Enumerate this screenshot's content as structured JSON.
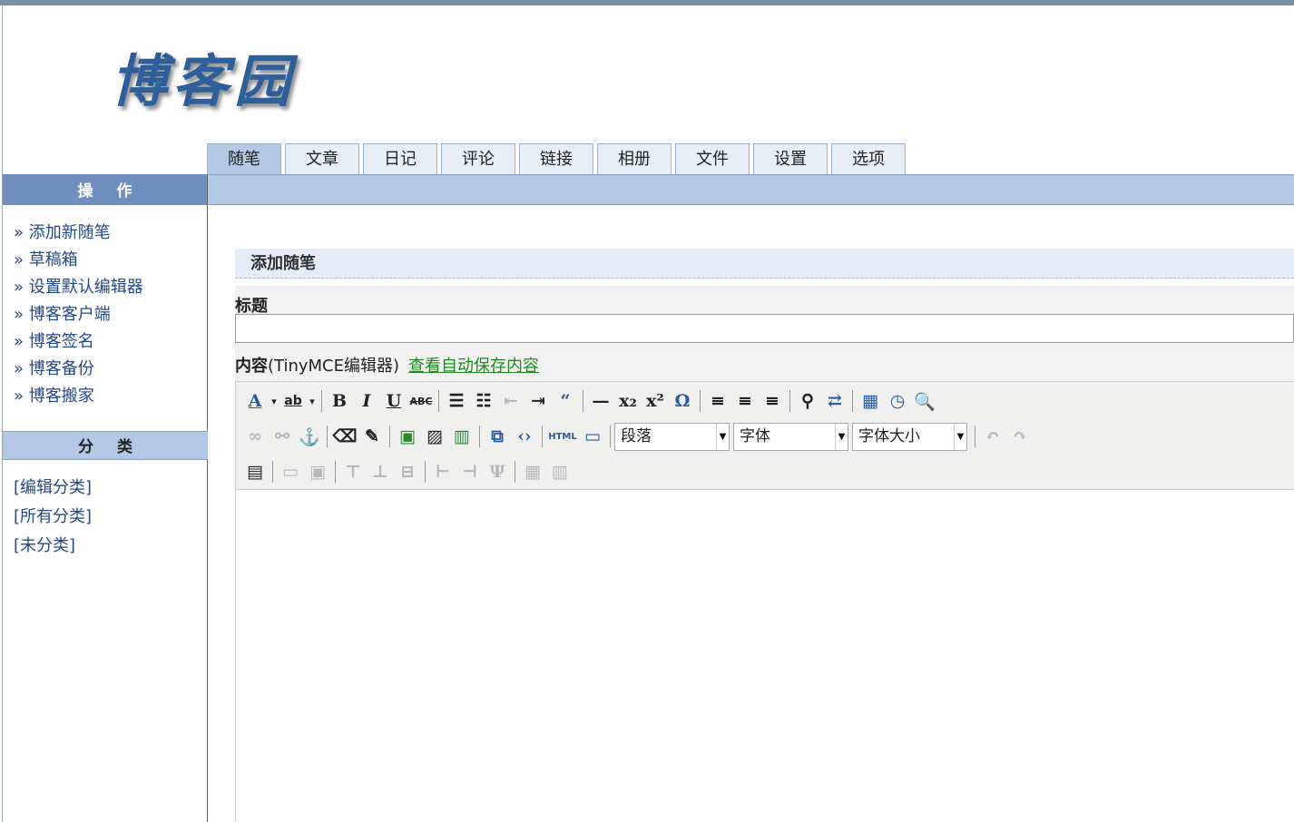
{
  "logo": {
    "text": "博客园"
  },
  "tabs": [
    {
      "label": "随笔",
      "active": true
    },
    {
      "label": "文章"
    },
    {
      "label": "日记"
    },
    {
      "label": "评论"
    },
    {
      "label": "链接"
    },
    {
      "label": "相册"
    },
    {
      "label": "文件"
    },
    {
      "label": "设置"
    },
    {
      "label": "选项"
    }
  ],
  "sidebar": {
    "ops_header": "操作",
    "ops": [
      "» 添加新随笔",
      "» 草稿箱",
      "» 设置默认编辑器",
      "» 博客客户端",
      "» 博客签名",
      "» 博客备份",
      "» 博客搬家"
    ],
    "cat_header": "分类",
    "cats": [
      "[编辑分类]",
      "[所有分类]",
      "[未分类]"
    ]
  },
  "main": {
    "section_title": "添加随笔",
    "title_label": "标题",
    "title_value": "",
    "content_label": "内容",
    "content_editor": "(TinyMCE编辑器)",
    "autosave_link": "查看自动保存内容"
  },
  "editor": {
    "format_select": "段落",
    "font_select": "字体",
    "size_select": "字体大小",
    "html_button": "HTML"
  }
}
